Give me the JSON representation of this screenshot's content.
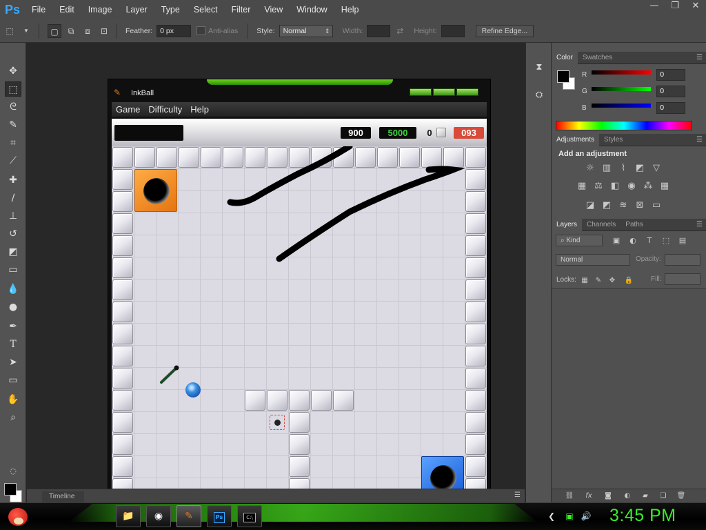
{
  "app": {
    "logo": "Ps"
  },
  "menubar": {
    "items": [
      "File",
      "Edit",
      "Image",
      "Layer",
      "Type",
      "Select",
      "Filter",
      "View",
      "Window",
      "Help"
    ]
  },
  "window_controls": {
    "minimize": "—",
    "restore": "❐",
    "close": "✕"
  },
  "options_bar": {
    "feather_label": "Feather:",
    "feather_value": "0 px",
    "antialias_label": "Anti-alias",
    "style_label": "Style:",
    "style_value": "Normal",
    "width_label": "Width:",
    "height_label": "Height:",
    "refine_edge_label": "Refine Edge..."
  },
  "timeline": {
    "label": "Timeline"
  },
  "color_panel": {
    "tabs": [
      "Color",
      "Swatches"
    ],
    "channels": [
      {
        "label": "R",
        "value": "0",
        "color": "#e02020"
      },
      {
        "label": "G",
        "value": "0",
        "color": "#22b830"
      },
      {
        "label": "B",
        "value": "0",
        "color": "#2030e0"
      }
    ]
  },
  "adjustments_panel": {
    "tabs": [
      "Adjustments",
      "Styles"
    ],
    "heading": "Add an adjustment"
  },
  "layers_panel": {
    "tabs": [
      "Layers",
      "Channels",
      "Paths"
    ],
    "kind_label": "Kind",
    "blend_value": "Normal",
    "opacity_label": "Opacity:",
    "locks_label": "Locks:",
    "fill_label": "Fill:"
  },
  "inkball": {
    "title": "InkBall",
    "menu": [
      "Game",
      "Difficulty",
      "Help"
    ],
    "score": "900",
    "target": "5000",
    "balls_count": "0",
    "timer": "093",
    "colors": {
      "orange_hole": "#f08a1c",
      "blue_hole": "#1f6ff0",
      "score_green": "#3fd43f",
      "timer_red": "#d94a3a"
    }
  },
  "taskbar": {
    "clock": "3:45 PM",
    "apps": [
      "start-angry-birds",
      "file-explorer",
      "chrome",
      "inkball",
      "photoshop",
      "command-prompt"
    ]
  }
}
